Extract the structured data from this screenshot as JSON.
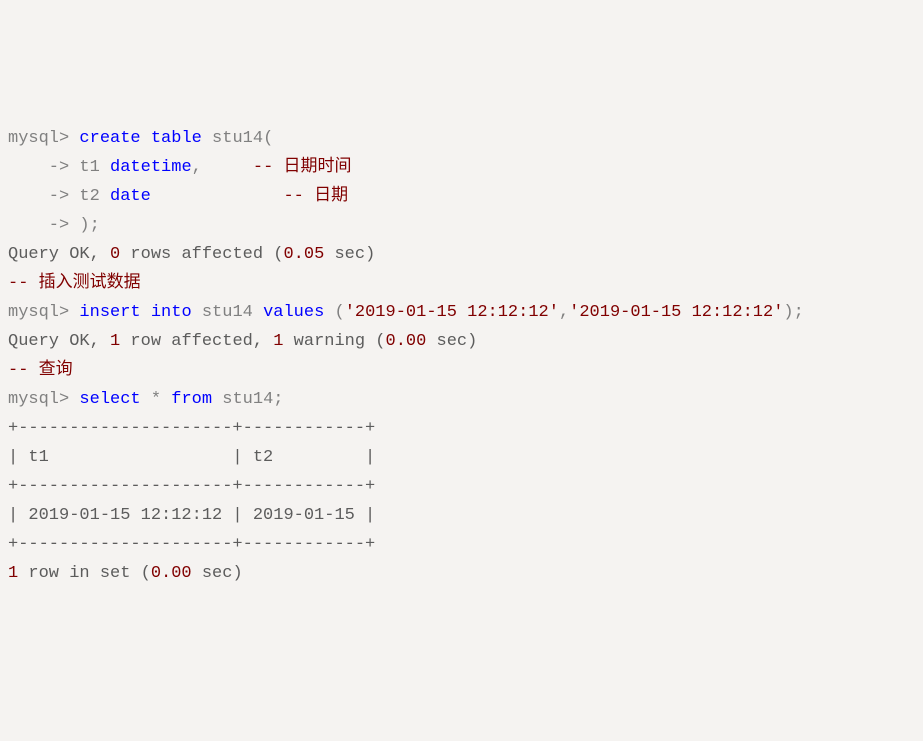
{
  "lines": {
    "l1_prompt": "mysql> ",
    "l1_create": "create",
    "l1_table": " table",
    "l1_name": " stu14",
    "l1_paren": "(",
    "l2_prompt": "    -> ",
    "l2_col": "t1 ",
    "l2_type": "datetime",
    "l2_comma": ",",
    "l2_space": "     ",
    "l2_comment": "-- 日期时间",
    "l3_prompt": "    -> ",
    "l3_col": "t2 ",
    "l3_type": "date",
    "l3_space": "             ",
    "l3_comment": "-- 日期",
    "l4_prompt": "    -> ",
    "l4_close": ");",
    "l5": "Query OK, 0 rows affected (0.05 sec)",
    "l5_query": "Query OK, ",
    "l5_num1": "0",
    "l5_mid": " rows affected (",
    "l5_num2": "0.05",
    "l5_end": " sec)",
    "l6_comment": "-- 插入测试数据",
    "l7_prompt": "mysql> ",
    "l7_insert": "insert",
    "l7_into": " into",
    "l7_tbl": " stu14 ",
    "l7_values": "values",
    "l7_open": " (",
    "l7_str1": "'2019-01-15 12:12:12'",
    "l7_comma": ",",
    "l7_str2": "'2019-01-15 12:12:12'",
    "l7_close": ");",
    "l8_query": "Query OK, ",
    "l8_num1": "1",
    "l8_mid": " row affected, ",
    "l8_num2": "1",
    "l8_warn": " warning (",
    "l8_num3": "0.00",
    "l8_end": " sec)",
    "l9_comment": "-- 查询",
    "l10_prompt": "mysql> ",
    "l10_select": "select",
    "l10_star": " * ",
    "l10_from": "from",
    "l10_tbl": " stu14",
    "l10_semi": ";",
    "border": "+---------------------+------------+",
    "header": "| t1                  | t2         |",
    "row": "| 2019-01-15 12:12:12 | 2019-01-15 |",
    "footer_num1": "1",
    "footer_mid": " row in set (",
    "footer_num2": "0.00",
    "footer_end": " sec)"
  }
}
